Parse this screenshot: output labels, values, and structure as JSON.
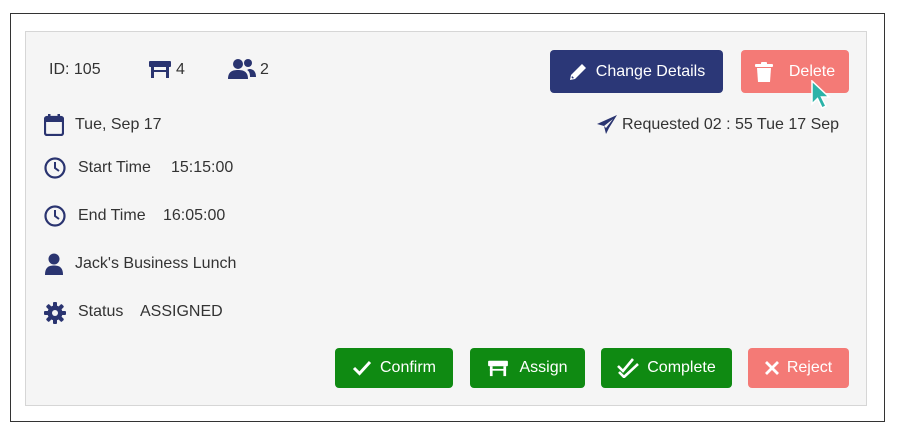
{
  "header": {
    "id_text": "ID: 105",
    "tables_count": "4",
    "guests_count": "2"
  },
  "actions_top": {
    "change_details_label": "Change Details",
    "delete_label": "Delete"
  },
  "details": {
    "date": "Tue, Sep 17",
    "requested": "Requested 02 : 55 Tue 17 Sep",
    "start_label": "Start Time",
    "start_value": "15:15:00",
    "end_label": "End Time",
    "end_value": "16:05:00",
    "name": "Jack's Business Lunch",
    "status_label": "Status",
    "status_value": "ASSIGNED"
  },
  "actions_bottom": {
    "confirm_label": "Confirm",
    "assign_label": "Assign",
    "complete_label": "Complete",
    "reject_label": "Reject"
  },
  "colors": {
    "navy": "#2b3777",
    "danger_light": "#f47a76",
    "success": "#0f8a12",
    "cursor": "#2bb3a8"
  },
  "icons": {
    "date": "calendar-icon",
    "requested": "paper-plane-icon",
    "start": "clock-icon",
    "end": "clock-icon",
    "name": "user-icon",
    "status": "gear-icon",
    "tables": "table-icon",
    "guests": "users-icon"
  }
}
